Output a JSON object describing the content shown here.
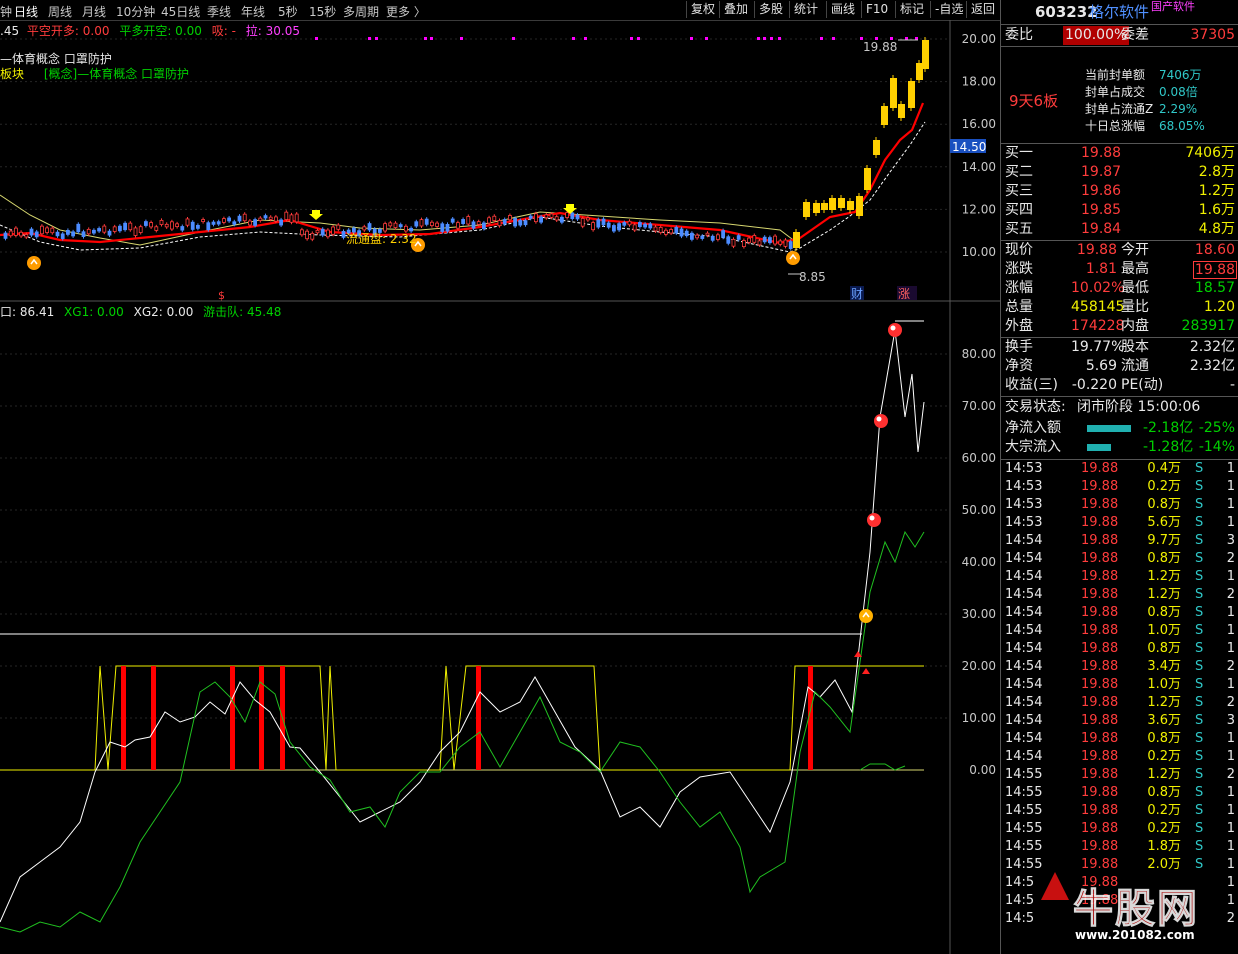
{
  "toolbar": {
    "left_fragment": "钟",
    "timeframes": [
      "日线",
      "周线",
      "月线",
      "10分钟",
      "45日线",
      "季线",
      "年线",
      "5秒",
      "15秒",
      "多周期",
      "更多 〉"
    ],
    "buttons": [
      "复权",
      "叠加",
      "多股",
      "统计",
      "画线",
      "F10",
      "标记",
      "-自选",
      "返回"
    ]
  },
  "main_chart": {
    "indicator_line": {
      "prefix": ".45",
      "a": "平空开多: 0.00",
      "b": "平多开空: 0.00",
      "c": "吸: -",
      "d": "拉: 30.05"
    },
    "concept1": "—体育概念 口罩防护",
    "concept2_prefix": "板块",
    "concept2": "[概念]—体育概念 口罩防护",
    "price_labels": [
      "20.00",
      "18.00",
      "16.00",
      "14.00",
      "12.00",
      "10.00"
    ],
    "current_price_tag": "14.50",
    "high_marker": "19.88",
    "low_marker": "8.85",
    "chip_label": "流通盘: 2.32",
    "bottom_tags": [
      "财",
      "涨"
    ],
    "bottom_left_tag": "$"
  },
  "sub_chart": {
    "header_a": "口: 86.41",
    "header_b": "XG1: 0.00",
    "header_c": "XG2: 0.00",
    "header_d": "游击队: 45.48",
    "axis_labels": [
      "80.00",
      "70.00",
      "60.00",
      "50.00",
      "40.00",
      "30.00",
      "20.00",
      "10.00",
      "0.00"
    ]
  },
  "right_panel": {
    "code": "603232",
    "name": "格尔软件",
    "tag": "国产软件",
    "weibi_label": "委比",
    "weibi_value": "100.00%",
    "weicha_label": "委差",
    "weicha_value": "37305",
    "streak": "9天6板",
    "seal_rows": [
      {
        "label": "当前封单额",
        "value": "7406万"
      },
      {
        "label": "封单占成交",
        "value": "0.08倍"
      },
      {
        "label": "封单占流通Z",
        "value": "2.29%"
      },
      {
        "label": "十日总涨幅",
        "value": "68.05%"
      }
    ],
    "bids": [
      {
        "label": "买一",
        "price": "19.88",
        "vol": "7406万"
      },
      {
        "label": "买二",
        "price": "19.87",
        "vol": "2.8万"
      },
      {
        "label": "买三",
        "price": "19.86",
        "vol": "1.2万"
      },
      {
        "label": "买四",
        "price": "19.85",
        "vol": "1.6万"
      },
      {
        "label": "买五",
        "price": "19.84",
        "vol": "4.8万"
      }
    ],
    "stats": [
      {
        "l1": "现价",
        "v1": "19.88",
        "l2": "今开",
        "v2": "18.60"
      },
      {
        "l1": "涨跌",
        "v1": "1.81",
        "l2": "最高",
        "v2": "19.88"
      },
      {
        "l1": "涨幅",
        "v1": "10.02%",
        "l2": "最低",
        "v2": "18.57"
      },
      {
        "l1": "总量",
        "v1": "458145",
        "l2": "量比",
        "v2": "1.20"
      },
      {
        "l1": "外盘",
        "v1": "174228",
        "l2": "内盘",
        "v2": "283917"
      }
    ],
    "stats2": [
      {
        "l1": "换手",
        "v1": "19.77%",
        "l2": "股本",
        "v2": "2.32亿"
      },
      {
        "l1": "净资",
        "v1": "5.69",
        "l2": "流通",
        "v2": "2.32亿"
      },
      {
        "l1": "收益(三)",
        "v1": "-0.220",
        "l2": "PE(动)",
        "v2": "-"
      }
    ],
    "trade_status_label": "交易状态:",
    "trade_status_value": "闭市阶段 15:00:06",
    "flows": [
      {
        "label": "净流入额",
        "value": "-2.18亿",
        "pct": "-25%"
      },
      {
        "label": "大宗流入",
        "value": "-1.28亿",
        "pct": "-14%"
      }
    ],
    "ticks": [
      {
        "t": "14:53",
        "p": "19.88",
        "v": "0.4万",
        "d": "S",
        "n": "1"
      },
      {
        "t": "14:53",
        "p": "19.88",
        "v": "0.2万",
        "d": "S",
        "n": "1"
      },
      {
        "t": "14:53",
        "p": "19.88",
        "v": "0.8万",
        "d": "S",
        "n": "1"
      },
      {
        "t": "14:53",
        "p": "19.88",
        "v": "5.6万",
        "d": "S",
        "n": "1"
      },
      {
        "t": "14:54",
        "p": "19.88",
        "v": "9.7万",
        "d": "S",
        "n": "3"
      },
      {
        "t": "14:54",
        "p": "19.88",
        "v": "0.8万",
        "d": "S",
        "n": "2"
      },
      {
        "t": "14:54",
        "p": "19.88",
        "v": "1.2万",
        "d": "S",
        "n": "1"
      },
      {
        "t": "14:54",
        "p": "19.88",
        "v": "1.2万",
        "d": "S",
        "n": "2"
      },
      {
        "t": "14:54",
        "p": "19.88",
        "v": "0.8万",
        "d": "S",
        "n": "1"
      },
      {
        "t": "14:54",
        "p": "19.88",
        "v": "1.0万",
        "d": "S",
        "n": "1"
      },
      {
        "t": "14:54",
        "p": "19.88",
        "v": "0.8万",
        "d": "S",
        "n": "1"
      },
      {
        "t": "14:54",
        "p": "19.88",
        "v": "3.4万",
        "d": "S",
        "n": "2"
      },
      {
        "t": "14:54",
        "p": "19.88",
        "v": "1.0万",
        "d": "S",
        "n": "1"
      },
      {
        "t": "14:54",
        "p": "19.88",
        "v": "1.2万",
        "d": "S",
        "n": "2"
      },
      {
        "t": "14:54",
        "p": "19.88",
        "v": "3.6万",
        "d": "S",
        "n": "3"
      },
      {
        "t": "14:54",
        "p": "19.88",
        "v": "0.8万",
        "d": "S",
        "n": "1"
      },
      {
        "t": "14:54",
        "p": "19.88",
        "v": "0.2万",
        "d": "S",
        "n": "1"
      },
      {
        "t": "14:55",
        "p": "19.88",
        "v": "1.2万",
        "d": "S",
        "n": "2"
      },
      {
        "t": "14:55",
        "p": "19.88",
        "v": "0.8万",
        "d": "S",
        "n": "1"
      },
      {
        "t": "14:55",
        "p": "19.88",
        "v": "0.2万",
        "d": "S",
        "n": "1"
      },
      {
        "t": "14:55",
        "p": "19.88",
        "v": "0.2万",
        "d": "S",
        "n": "1"
      },
      {
        "t": "14:55",
        "p": "19.88",
        "v": "1.8万",
        "d": "S",
        "n": "1"
      },
      {
        "t": "14:55",
        "p": "19.88",
        "v": "2.0万",
        "d": "S",
        "n": "1"
      },
      {
        "t": "14:5",
        "p": "19.88",
        "v": "",
        "d": "",
        "n": "1"
      },
      {
        "t": "14:5",
        "p": "19.88",
        "v": "",
        "d": "",
        "n": "1"
      },
      {
        "t": "14:5",
        "p": "",
        "v": "",
        "d": "",
        "n": "2"
      }
    ],
    "watermark_text": "www.201082.com",
    "watermark_brand": "牛股网"
  },
  "colors": {
    "up": "#ff3c3c",
    "down": "#00d000",
    "ma_red": "#ff0000",
    "yellow": "#f0f000",
    "grid": "#2a2a2a"
  }
}
